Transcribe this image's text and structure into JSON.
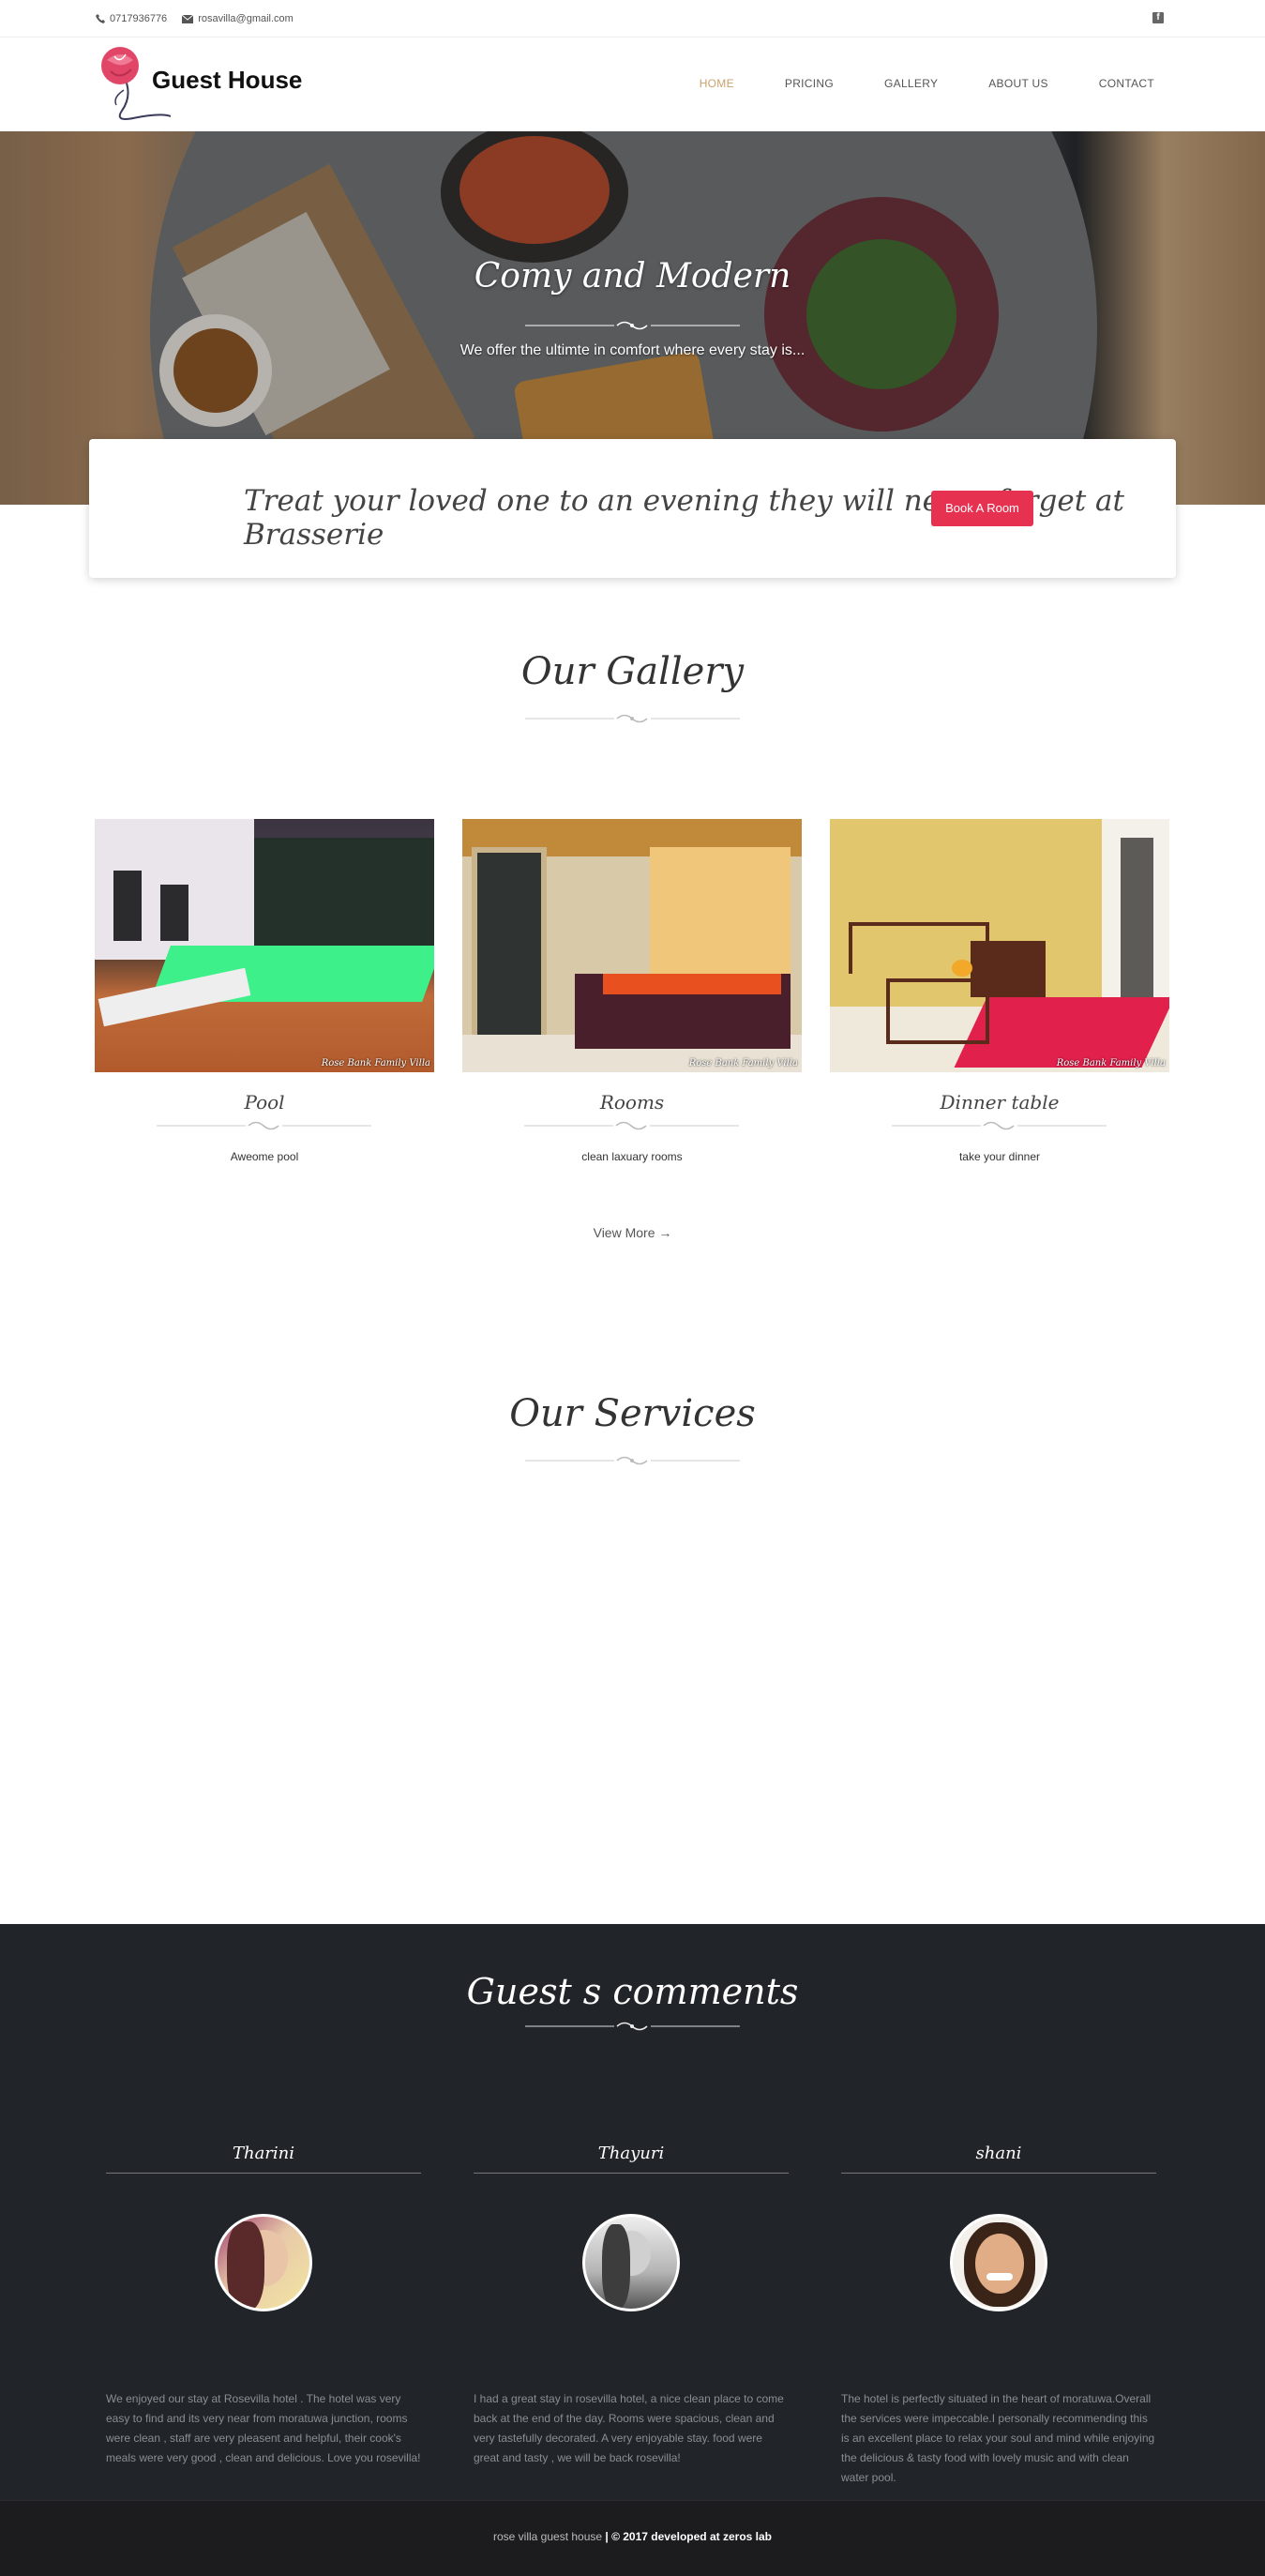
{
  "topbar": {
    "phone": "0717936776",
    "email": "rosavilla@gmail.com",
    "social_icon": "facebook-icon"
  },
  "header": {
    "brand": "Guest House",
    "nav": [
      "HOME",
      "PRICING",
      "GALLERY",
      "ABOUT US",
      "CONTACT"
    ],
    "active_nav": "HOME"
  },
  "hero": {
    "title": "Comy and Modern",
    "subtitle": "We offer the ultimte in comfort where every stay is..."
  },
  "promo": {
    "text": "Treat your loved one to an evening they will never forget at Brasserie",
    "button": "Book A Room"
  },
  "gallery": {
    "title": "Our Gallery",
    "items": [
      {
        "name": "Pool",
        "desc": "Aweome pool",
        "watermark": "Rose Bank Family Villa"
      },
      {
        "name": "Rooms",
        "desc": "clean laxuary rooms",
        "watermark": "Rose Bank Family Villa"
      },
      {
        "name": "Dinner table",
        "desc": "take your dinner",
        "watermark": "Rose Bank Family Villa"
      }
    ],
    "view_more": "View More →"
  },
  "services": {
    "title": "Our Services"
  },
  "comments": {
    "title": "Guest s comments",
    "items": [
      {
        "name": "Tharini",
        "text": " We enjoyed our stay at Rosevilla hotel . The hotel was very easy to find and its very near from moratuwa junction, rooms were clean , staff are very pleasent and helpful, their cook's meals were very good , clean and delicious. Love you rosevilla!"
      },
      {
        "name": "Thayuri",
        "text": "I had a great stay in rosevilla hotel, a nice clean place to come back at the end of the day. Rooms were spacious, clean and very tastefully decorated. A very enjoyable stay. food were great and tasty , we will be back rosevilla!"
      },
      {
        "name": "shani",
        "text": "The hotel is perfectly situated in the heart of moratuwa.Overall the services were impeccable.I personally recommending this is an excellent place to relax your soul and mind while enjoying the delicious & tasty food with lovely music and with clean water pool."
      }
    ]
  },
  "footer": {
    "left": "rose villa guest house ",
    "right": "| © 2017 developed at zeros lab"
  },
  "colors": {
    "accent": "#e63150",
    "nav_active": "#c7a26b",
    "dark_section": "#212529"
  }
}
